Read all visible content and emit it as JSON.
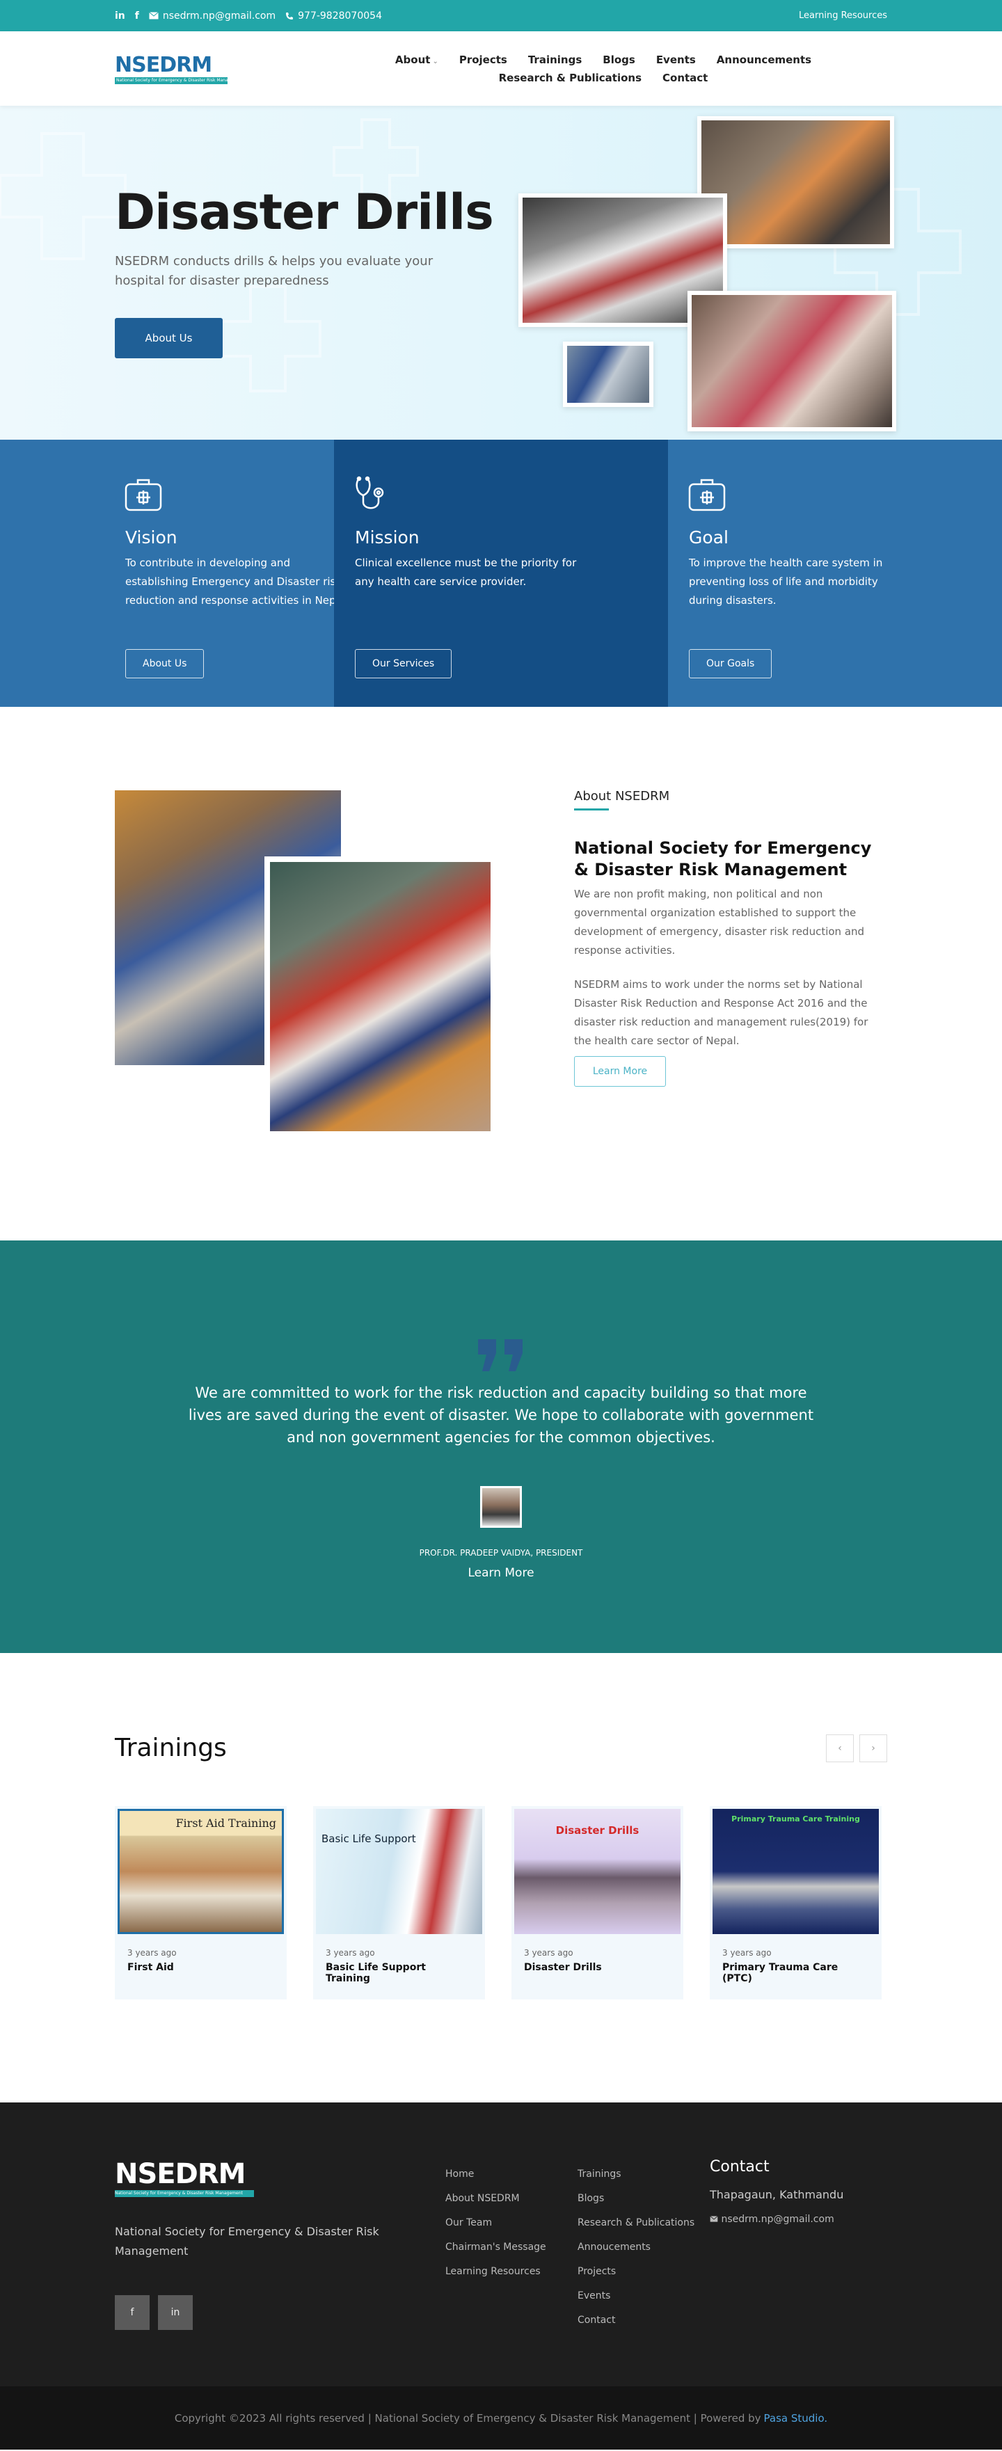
{
  "topbar": {
    "linkedin": "in",
    "facebook": "f",
    "email": "nsedrm.np@gmail.com",
    "phone": "977-9828070054",
    "learning_resources": "Learning Resources"
  },
  "header": {
    "logo_text": "NSEDRM",
    "logo_tagline": "National Society for Emergency & Disaster Risk Management",
    "nav": [
      "About",
      "Projects",
      "Trainings",
      "Blogs",
      "Events",
      "Announcements",
      "Research & Publications",
      "Contact"
    ]
  },
  "hero": {
    "title": "Disaster Drills",
    "subtitle": "NSEDRM conducts drills & helps you evaluate your hospital for disaster preparedness",
    "button": "About Us"
  },
  "features": [
    {
      "icon": "first-aid-kit-icon",
      "title": "Vision",
      "text": "To contribute in developing and establishing Emergency and Disaster risk reduction and response activities in Nepal",
      "button": "About Us"
    },
    {
      "icon": "stethoscope-icon",
      "title": "Mission",
      "text": "Clinical excellence must be the priority for any health care service provider.",
      "button": "Our Services"
    },
    {
      "icon": "first-aid-kit-icon",
      "title": "Goal",
      "text": "To improve the health care system in preventing loss of life and morbidity during disasters.",
      "button": "Our Goals"
    }
  ],
  "about": {
    "label": "About NSEDRM",
    "title": "National Society for Emergency & Disaster Risk Management",
    "p1": "We are non profit making, non political and non governmental organization established to support the development of emergency, disaster risk reduction and response activities.",
    "p2": "NSEDRM aims to work under the norms set by National Disaster Risk Reduction and Response Act 2016 and the disaster risk reduction and management rules(2019) for the health care sector of Nepal.",
    "button": "Learn More"
  },
  "quote": {
    "text": "We are committed to work for the risk reduction and capacity building so that more lives are saved during the event of disaster. We hope to collaborate with government and non government agencies for the common objectives.",
    "author": "PROF.DR. PRADEEP VAIDYA, PRESIDENT",
    "link": "Learn More"
  },
  "trainings": {
    "title": "Trainings",
    "prev": "‹",
    "next": "›",
    "cards": [
      {
        "image_text": "First Aid Training",
        "date": "3 years ago",
        "title": "First Aid"
      },
      {
        "image_text": "Basic Life Support",
        "date": "3 years ago",
        "title": "Basic Life Support Training"
      },
      {
        "image_text": "Disaster Drills",
        "date": "3 years ago",
        "title": "Disaster Drills"
      },
      {
        "image_text": "Primary Trauma Care Training",
        "date": "3 years ago",
        "title": "Primary Trauma Care (PTC)"
      }
    ]
  },
  "footer": {
    "logo_text": "NSEDRM",
    "description": "National Society for Emergency & Disaster Risk Management",
    "social": [
      "f",
      "in"
    ],
    "col1": [
      "Home",
      "About NSEDRM",
      "Our Team",
      "Chairman's Message",
      "Learning Resources"
    ],
    "col2": [
      "Trainings",
      "Blogs",
      "Research & Publications",
      "Annoucements",
      "Projects",
      "Events",
      "Contact"
    ],
    "contact_title": "Contact",
    "address": "Thapagaun, Kathmandu",
    "email": "nsedrm.np@gmail.com"
  },
  "bottom": {
    "copyright": "Copyright ©2023 All rights reserved | National Society of Emergency & Disaster Risk Management | Powered by",
    "powered_by": "Pasa Studio."
  },
  "colors": {
    "teal": "#22a6a8",
    "blue": "#2f72ab",
    "navy": "#144e85",
    "quote_bg": "#1e7b7a",
    "footer_bg": "#1e1e1e"
  }
}
